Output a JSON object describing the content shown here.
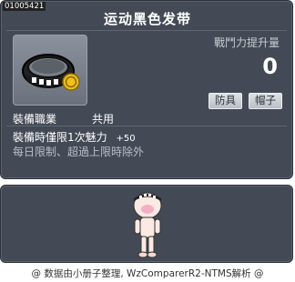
{
  "item": {
    "id": "01005421",
    "name": "运动黑色发带",
    "stat_label": "戰鬥力提升量",
    "stat_value": "0",
    "tags": [
      "防具",
      "帽子"
    ],
    "job_label": "裝備職業",
    "job_value": "共用",
    "effect_label": "裝備時僅限1次魅力",
    "effect_value": "+50",
    "limit_text": "每日限制、超過上限時除外",
    "icon": "black-headband-icon"
  },
  "preview": {
    "character": "character-preview"
  },
  "footer": {
    "text": "@ 数据由小册子整理, WzComparerR2-NTMS解析 @"
  },
  "colors": {
    "panel": "#434a55",
    "border": "#2e333b",
    "text": "#ffffff",
    "muted": "#b9bec6",
    "coin": "#f0c020"
  }
}
